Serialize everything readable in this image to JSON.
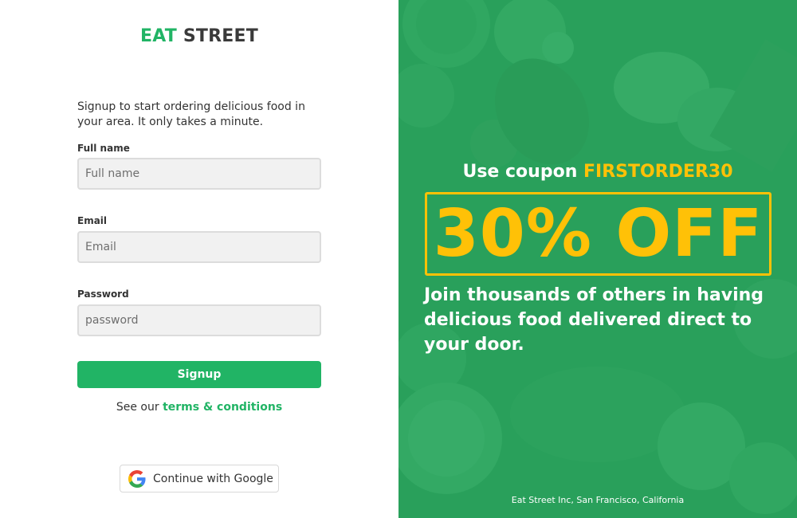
{
  "brand": {
    "part1": "EAT",
    "part2": "STREET"
  },
  "intro": "Signup to start ordering delicious food in your area. It only takes a minute.",
  "form": {
    "full_name": {
      "label": "Full name",
      "placeholder": "Full name",
      "value": ""
    },
    "email": {
      "label": "Email",
      "placeholder": "Email",
      "value": ""
    },
    "password": {
      "label": "Password",
      "placeholder": "password",
      "value": ""
    },
    "submit_label": "Signup"
  },
  "terms": {
    "prefix": "See our",
    "link": "terms & conditions"
  },
  "google": {
    "label": "Continue with Google",
    "icon": "google-g-icon"
  },
  "promo": {
    "coupon_prefix": "Use coupon",
    "coupon_code": "FIRSTORDER30",
    "offer": "30% OFF",
    "tagline": "Join thousands of others in having delicious food delivered direct to your door.",
    "footer": "Eat Street Inc, San Francisco, California"
  },
  "colors": {
    "brand_green": "#21b465",
    "accent_yellow": "#ffc107",
    "panel_green": "#28aa5f"
  }
}
